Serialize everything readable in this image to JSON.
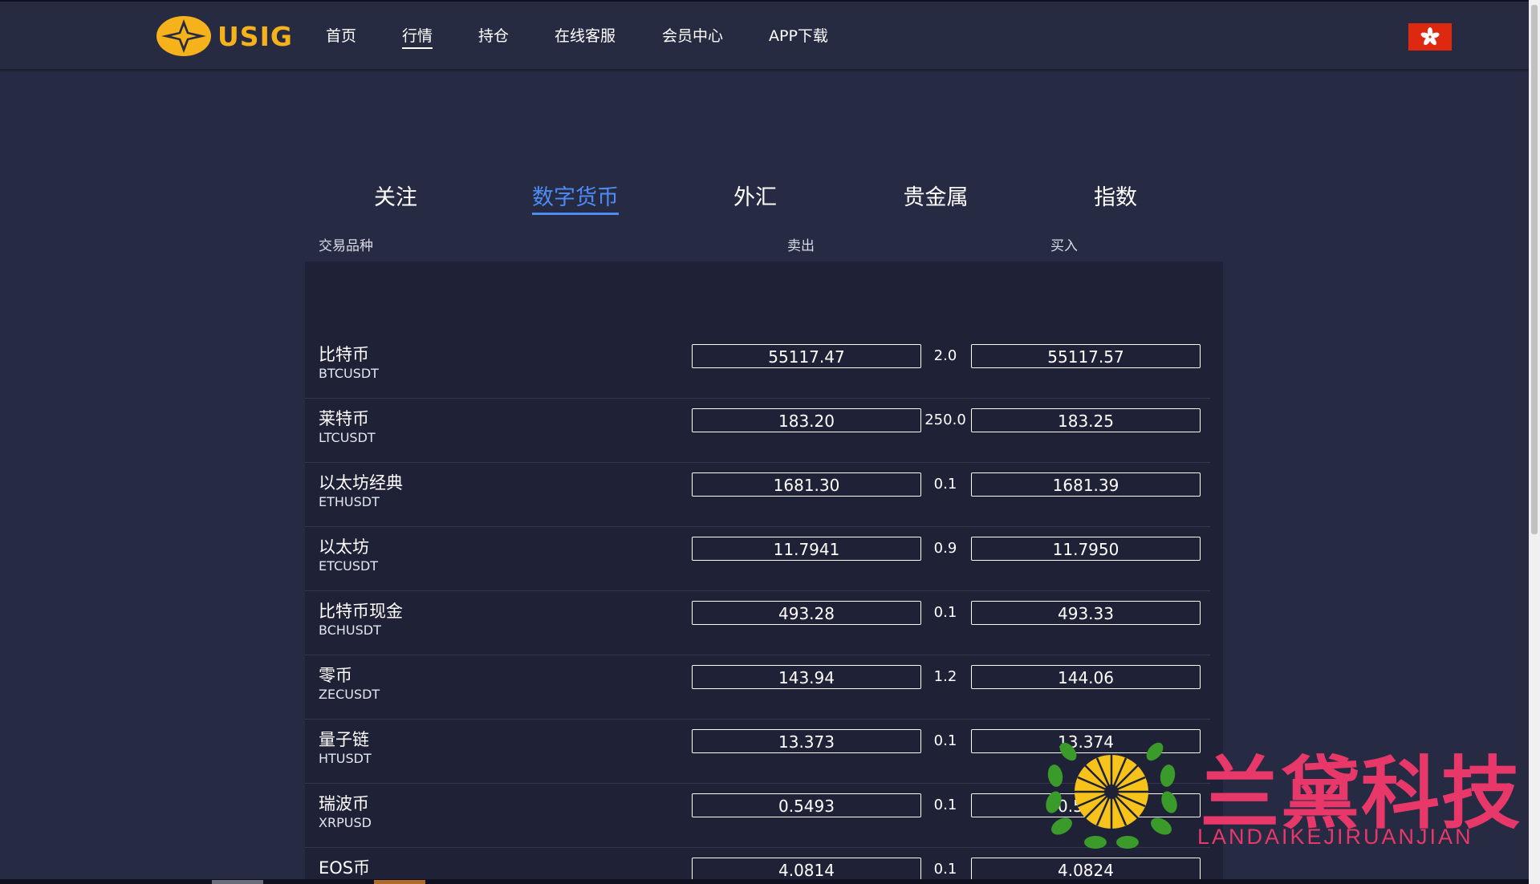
{
  "brand": {
    "name": "USIG",
    "accent": "#f5b21a"
  },
  "nav": [
    {
      "label": "首页"
    },
    {
      "label": "行情",
      "active": true
    },
    {
      "label": "持仓"
    },
    {
      "label": "在线客服"
    },
    {
      "label": "会员中心"
    },
    {
      "label": "APP下载"
    }
  ],
  "language_flag": {
    "icon": "hong-kong-flag-icon",
    "color": "#de2910"
  },
  "tabs": [
    {
      "label": "关注"
    },
    {
      "label": "数字货币",
      "active": true
    },
    {
      "label": "外汇"
    },
    {
      "label": "贵金属"
    },
    {
      "label": "指数"
    }
  ],
  "columns": {
    "symbol": "交易品种",
    "sell": "卖出",
    "buy": "买入"
  },
  "quotes": [
    {
      "name": "比特币",
      "code": "BTCUSDT",
      "sell": "55117.47",
      "spread": "2.0",
      "buy": "55117.57"
    },
    {
      "name": "莱特币",
      "code": "LTCUSDT",
      "sell": "183.20",
      "spread": "250.0",
      "buy": "183.25"
    },
    {
      "name": "以太坊经典",
      "code": "ETHUSDT",
      "sell": "1681.30",
      "spread": "0.1",
      "buy": "1681.39"
    },
    {
      "name": "以太坊",
      "code": "ETCUSDT",
      "sell": "11.7941",
      "spread": "0.9",
      "buy": "11.7950"
    },
    {
      "name": "比特币现金",
      "code": "BCHUSDT",
      "sell": "493.28",
      "spread": "0.1",
      "buy": "493.33"
    },
    {
      "name": "零币",
      "code": "ZECUSDT",
      "sell": "143.94",
      "spread": "1.2",
      "buy": "144.06"
    },
    {
      "name": "量子链",
      "code": "HTUSDT",
      "sell": "13.373",
      "spread": "0.1",
      "buy": "13.374"
    },
    {
      "name": "瑞波币",
      "code": "XRPUSD",
      "sell": "0.5493",
      "spread": "0.1",
      "buy": "0.5494"
    },
    {
      "name": "EOS币",
      "code": "",
      "sell": "4.0814",
      "spread": "0.1",
      "buy": "4.0824"
    }
  ],
  "watermark": {
    "title": "兰黛科技",
    "subtitle": "LANDAIKEJIRUANJIAN",
    "color": "#e8386a"
  }
}
